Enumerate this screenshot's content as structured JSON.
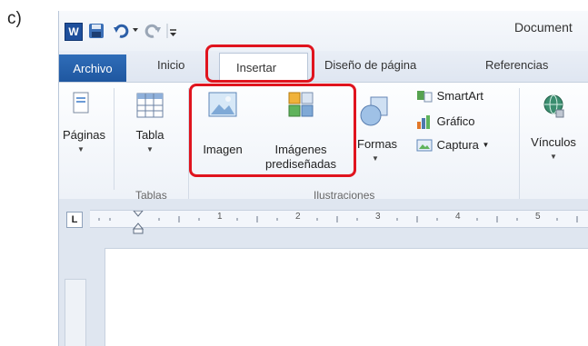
{
  "caption": "c)",
  "title": "Document",
  "tabs": {
    "archivo": "Archivo",
    "inicio": "Inicio",
    "insertar": "Insertar",
    "diseno": "Diseño de página",
    "referencias": "Referencias"
  },
  "ribbon": {
    "paginas": "Páginas",
    "tabla": "Tabla",
    "imagen": "Imagen",
    "imagenes_line1": "Imágenes",
    "imagenes_line2": "prediseñadas",
    "formas": "Formas",
    "smartart": "SmartArt",
    "grafico": "Gráfico",
    "captura": "Captura",
    "vinculos": "Vínculos",
    "group_tablas": "Tablas",
    "group_ilustraciones": "Ilustraciones"
  },
  "ruler": {
    "numbers": [
      "1",
      "2",
      "3",
      "4",
      "5"
    ]
  },
  "colors": {
    "highlight": "#e0141e",
    "archivo_tab": "#2f6db8"
  }
}
